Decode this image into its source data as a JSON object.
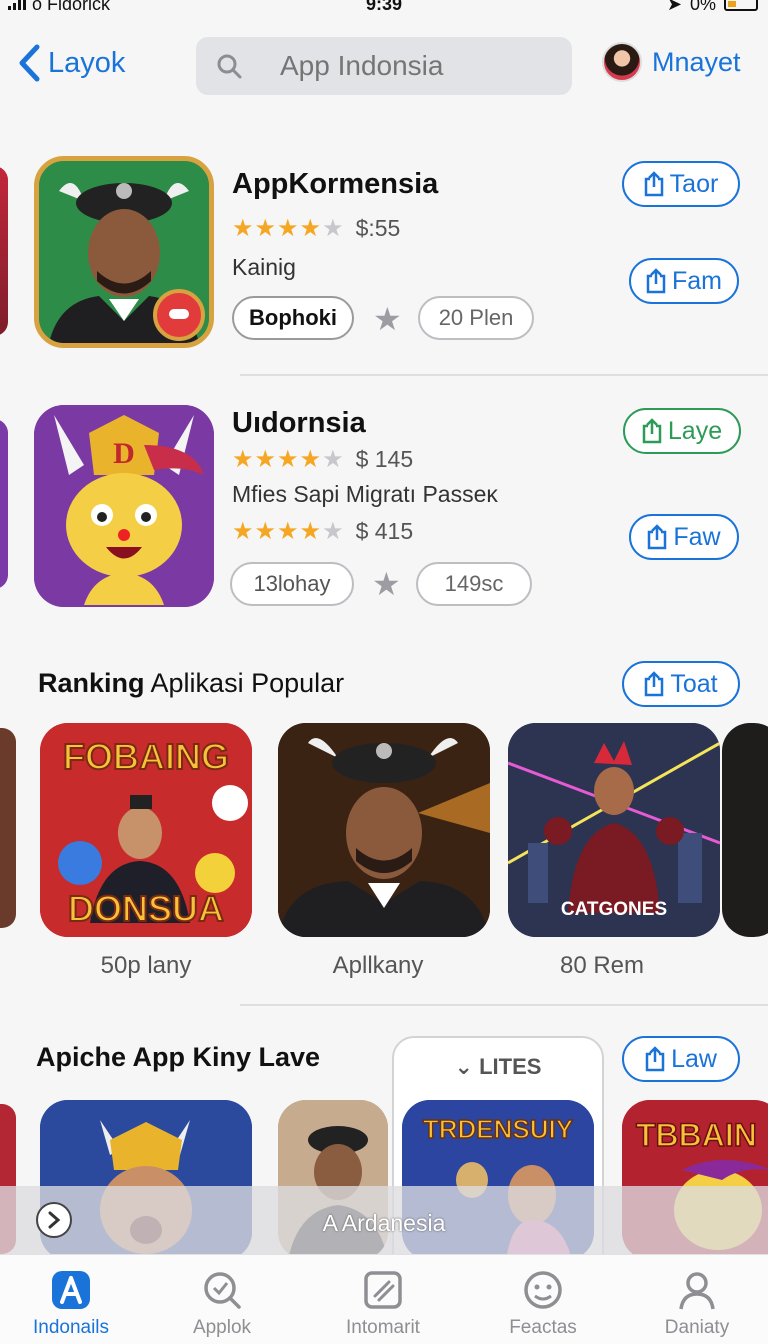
{
  "status": {
    "carrier": "o Fidorick",
    "time": "9:39",
    "battery": "0%"
  },
  "header": {
    "back_label": "Layok",
    "search_placeholder": "App Indonsia",
    "profile_name": "Mnayet"
  },
  "apps": [
    {
      "title": "AppKormensia",
      "rating_stars": "★★★★",
      "rating_empty": "★",
      "price": "$:55",
      "subtitle": "Kainig",
      "tag": "Bophoki",
      "plan": "20 Plen",
      "button_top": "Taor",
      "button_bottom": "Fam"
    },
    {
      "title": "Uıdornsia",
      "rating_stars": "★★★★",
      "rating_empty": "★",
      "price": "$ 145",
      "subtitle": "Mfies Sapi Migratı Passeĸ",
      "rating2_stars": "★★★★",
      "rating2_empty": "★",
      "price2": "$ 415",
      "tag": "13lohay",
      "plan": "149sc",
      "button_top": "Laye",
      "button_bottom": "Faw"
    }
  ],
  "ranking": {
    "title_bold": "Ranking",
    "title_rest": " Aplikasi Popular",
    "button": "Toat",
    "items": [
      {
        "label": "50p lany",
        "art_top": "FOBAING",
        "art_bottom": "DONSUA"
      },
      {
        "label": "Apllkany"
      },
      {
        "label": "80 Rem",
        "art_caption": "CATGONES"
      }
    ]
  },
  "apiche": {
    "title": "Apiche App Kiny Lave",
    "button": "Law",
    "lites_label": "LITES",
    "card_art": "TRDENSUIY",
    "right_art": "TBBAIN"
  },
  "banner": {
    "text": "A Ardanesia"
  },
  "tabs": [
    {
      "label": "Indonails",
      "icon": "app-store-icon"
    },
    {
      "label": "Applok",
      "icon": "search-icon"
    },
    {
      "label": "Intomarit",
      "icon": "edit-icon"
    },
    {
      "label": "Feactas",
      "icon": "face-icon"
    },
    {
      "label": "Daniaty",
      "icon": "person-icon"
    }
  ],
  "colors": {
    "accent": "#1a73d9",
    "green": "#2e9a57",
    "star": "#f5a623"
  }
}
